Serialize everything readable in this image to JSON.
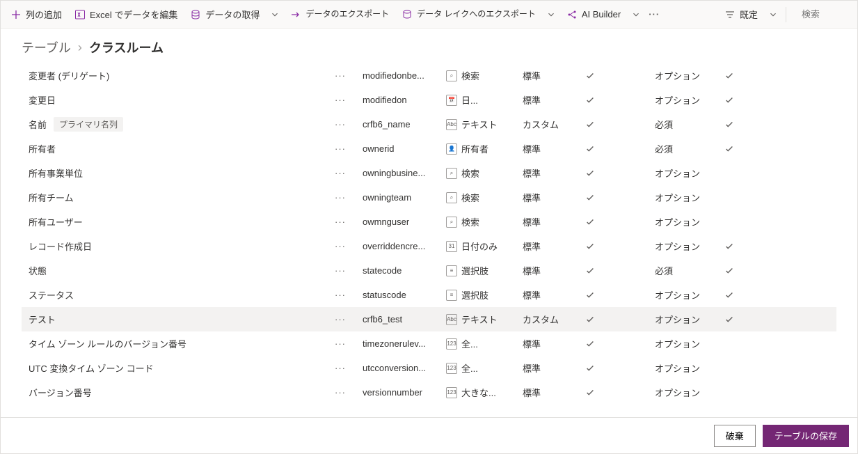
{
  "toolbar": {
    "add_column": "列の追加",
    "edit_excel": "Excel でデータを編集",
    "get_data": "データの取得",
    "export_data": "データのエクスポート",
    "export_lake": "データ レイクへのエクスポート",
    "ai_builder": "AI Builder",
    "default_view": "既定",
    "search_placeholder": "検索"
  },
  "breadcrumb": {
    "root": "テーブル",
    "current": "クラスルーム"
  },
  "tag_primary_name": "プライマリ名列",
  "rows": [
    {
      "display": "変更者 (デリゲート)",
      "sys": "modifiedonbe...",
      "dticon": "lookup",
      "dtype": "検索",
      "type": "標準",
      "chk1": true,
      "req": "オプション",
      "chk2": true
    },
    {
      "display": "変更日",
      "sys": "modifiedon",
      "dticon": "datetime",
      "dtype": "日...",
      "type": "標準",
      "chk1": true,
      "req": "オプション",
      "chk2": true
    },
    {
      "display": "名前",
      "sys": "crfb6_name",
      "dticon": "text",
      "dtype": "テキスト",
      "type": "カスタム",
      "chk1": true,
      "req": "必須",
      "chk2": true,
      "tag": true
    },
    {
      "display": "所有者",
      "sys": "ownerid",
      "dticon": "owner",
      "dtype": "所有者",
      "type": "標準",
      "chk1": true,
      "req": "必須",
      "chk2": true
    },
    {
      "display": "所有事業単位",
      "sys": "owningbusine...",
      "dticon": "lookup",
      "dtype": "検索",
      "type": "標準",
      "chk1": true,
      "req": "オプション",
      "chk2": false
    },
    {
      "display": "所有チーム",
      "sys": "owningteam",
      "dticon": "lookup",
      "dtype": "検索",
      "type": "標準",
      "chk1": true,
      "req": "オプション",
      "chk2": false
    },
    {
      "display": "所有ユーザー",
      "sys": "owmnguser",
      "dticon": "lookup",
      "dtype": "検索",
      "type": "標準",
      "chk1": true,
      "req": "オプション",
      "chk2": false
    },
    {
      "display": "レコード作成日",
      "sys": "overriddencre...",
      "dticon": "date",
      "dtype": "日付のみ",
      "type": "標準",
      "chk1": true,
      "req": "オプション",
      "chk2": true
    },
    {
      "display": "状態",
      "sys": "statecode",
      "dticon": "option",
      "dtype": "選択肢",
      "type": "標準",
      "chk1": true,
      "req": "必須",
      "chk2": true
    },
    {
      "display": "ステータス",
      "sys": "statuscode",
      "dticon": "option",
      "dtype": "選択肢",
      "type": "標準",
      "chk1": true,
      "req": "オプション",
      "chk2": true
    },
    {
      "display": "テスト",
      "sys": "crfb6_test",
      "dticon": "text",
      "dtype": "テキスト",
      "type": "カスタム",
      "chk1": true,
      "req": "オプション",
      "chk2": true,
      "selected": true
    },
    {
      "display": "タイム ゾーン ルールのバージョン番号",
      "sys": "timezonerulev...",
      "dticon": "number",
      "dtype": "全...",
      "type": "標準",
      "chk1": true,
      "req": "オプション",
      "chk2": false
    },
    {
      "display": "UTC 変換タイム ゾーン コード",
      "sys": "utcconversion...",
      "dticon": "number",
      "dtype": "全...",
      "type": "標準",
      "chk1": true,
      "req": "オプション",
      "chk2": false
    },
    {
      "display": "バージョン番号",
      "sys": "versionnumber",
      "dticon": "bignum",
      "dtype": "大きな...",
      "type": "標準",
      "chk1": true,
      "req": "オプション",
      "chk2": false
    }
  ],
  "footer": {
    "discard": "破棄",
    "save": "テーブルの保存"
  }
}
